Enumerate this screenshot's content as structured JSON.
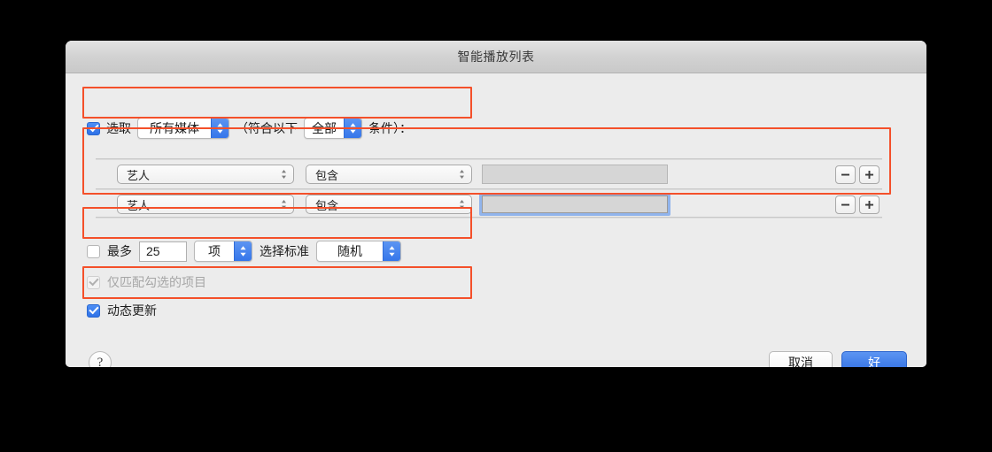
{
  "window": {
    "title": "智能播放列表"
  },
  "match_row": {
    "checkbox_checked": true,
    "label": "选取",
    "source_value": "所有媒体",
    "prefix": "（符合以下",
    "rule_value": "全部",
    "suffix": "条件）："
  },
  "criteria": {
    "rows": [
      {
        "field_value": "艺人",
        "operator_value": "包含",
        "text_value": "",
        "focused": false,
        "remove_label": "−",
        "add_label": "+"
      },
      {
        "field_value": "艺人",
        "operator_value": "包含",
        "text_value": "",
        "focused": true,
        "remove_label": "−",
        "add_label": "+"
      }
    ]
  },
  "limit_row": {
    "checkbox_checked": false,
    "label": "最多",
    "amount": "25",
    "unit_value": "项",
    "selected_by_label": "选择标准",
    "order_value": "随机"
  },
  "only_checked_row": {
    "checkbox_checked": true,
    "enabled": false,
    "label": "仅匹配勾选的项目"
  },
  "live_update_row": {
    "checkbox_checked": true,
    "label": "动态更新"
  },
  "footer": {
    "help_label": "?",
    "cancel_label": "取消",
    "ok_label": "好"
  },
  "colors": {
    "accent_blue": "#3576ea",
    "annotation_red": "#f4502a",
    "window_bg": "#ececec",
    "titlebar_top": "#e3e3e3",
    "focus_ring": "#91b4ec"
  }
}
